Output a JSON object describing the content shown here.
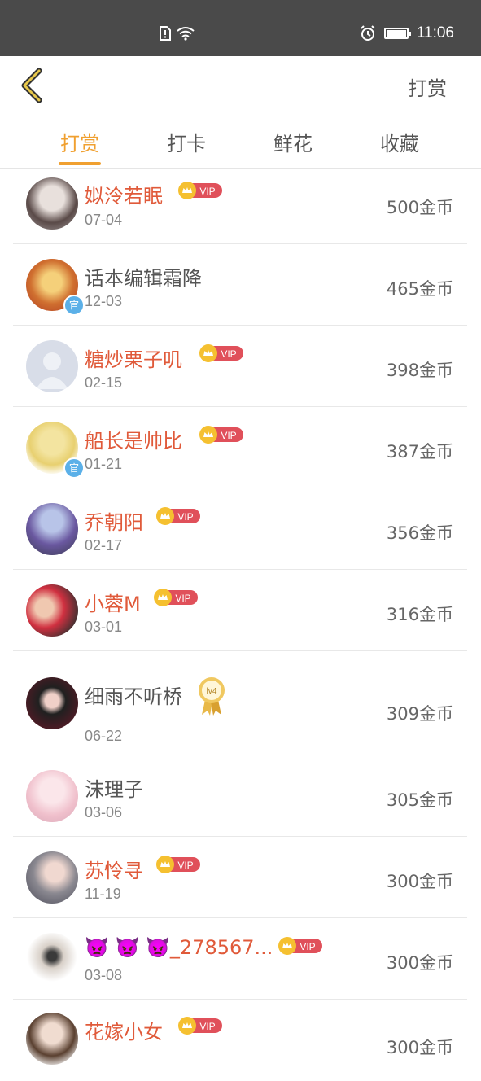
{
  "status_bar": {
    "time": "11:06"
  },
  "header": {
    "action_label": "打赏"
  },
  "tabs": [
    {
      "label": "打赏",
      "active": true
    },
    {
      "label": "打卡",
      "active": false
    },
    {
      "label": "鲜花",
      "active": false
    },
    {
      "label": "收藏",
      "active": false
    }
  ],
  "vip_label": "VIP",
  "official_badge": "官",
  "level_badge": "lv4",
  "entries": [
    {
      "name": "姒泠若眠",
      "date": "07-04",
      "amount": "500金币",
      "vip": true,
      "official": false
    },
    {
      "name": "话本编辑霜降",
      "date": "12-03",
      "amount": "465金币",
      "vip": false,
      "official": true
    },
    {
      "name": "糖炒栗子叽",
      "date": "02-15",
      "amount": "398金币",
      "vip": true,
      "official": false
    },
    {
      "name": "船长是帅比",
      "date": "01-21",
      "amount": "387金币",
      "vip": true,
      "official": true
    },
    {
      "name": "乔朝阳",
      "date": "02-17",
      "amount": "356金币",
      "vip": true,
      "official": false
    },
    {
      "name": "小蓉M",
      "date": "03-01",
      "amount": "316金币",
      "vip": true,
      "official": false
    },
    {
      "name": "细雨不听桥",
      "date": "06-22",
      "amount": "309金币",
      "vip": false,
      "official": false,
      "level": true
    },
    {
      "name": "沫理子",
      "date": "03-06",
      "amount": "305金币",
      "vip": false,
      "official": false
    },
    {
      "name": "苏怜寻",
      "date": "11-19",
      "amount": "300金币",
      "vip": true,
      "official": false
    },
    {
      "name": "👿 👿 👿_278567...",
      "date": "03-08",
      "amount": "300金币",
      "vip": true,
      "official": false
    },
    {
      "name": "花嫁小女",
      "date": "",
      "amount": "300金币",
      "vip": true,
      "official": false
    }
  ],
  "colors": {
    "accent": "#f0a030",
    "vip_name": "#e05a3a",
    "status_bar": "#4a4a4a"
  }
}
